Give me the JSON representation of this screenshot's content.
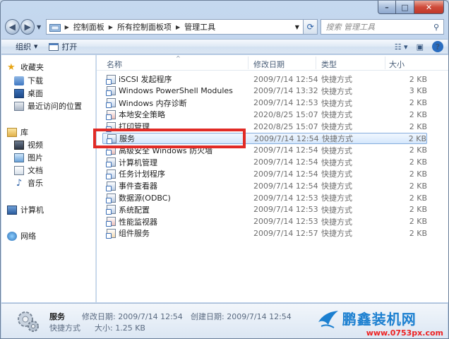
{
  "window": {
    "controls": {
      "minimize": "–",
      "maximize": "□",
      "close": "✕"
    }
  },
  "address": {
    "crumbs": [
      "控制面板",
      "所有控制面板项",
      "管理工具"
    ]
  },
  "search": {
    "placeholder": "搜索 管理工具"
  },
  "toolbar": {
    "organize": "组织",
    "open": "打开"
  },
  "nav": {
    "favorites": "收藏夹",
    "downloads": "下载",
    "desktop": "桌面",
    "recent": "最近访问的位置",
    "libraries": "库",
    "videos": "视频",
    "pictures": "图片",
    "documents": "文档",
    "music": "音乐",
    "computer": "计算机",
    "network": "网络"
  },
  "columns": {
    "name": "名称",
    "date": "修改日期",
    "type": "类型",
    "size": "大小"
  },
  "files": [
    {
      "name": "iSCSI 发起程序",
      "date": "2009/7/14 12:54",
      "type": "快捷方式",
      "size": "2 KB"
    },
    {
      "name": "Windows PowerShell Modules",
      "date": "2009/7/14 13:32",
      "type": "快捷方式",
      "size": "3 KB"
    },
    {
      "name": "Windows 内存诊断",
      "date": "2009/7/14 12:53",
      "type": "快捷方式",
      "size": "2 KB"
    },
    {
      "name": "本地安全策略",
      "date": "2020/8/25 15:07",
      "type": "快捷方式",
      "size": "2 KB"
    },
    {
      "name": "打印管理",
      "date": "2020/8/25 15:07",
      "type": "快捷方式",
      "size": "2 KB"
    },
    {
      "name": "服务",
      "date": "2009/7/14 12:54",
      "type": "快捷方式",
      "size": "2 KB"
    },
    {
      "name": "高级安全 Windows 防火墙",
      "date": "2009/7/14 12:54",
      "type": "快捷方式",
      "size": "2 KB"
    },
    {
      "name": "计算机管理",
      "date": "2009/7/14 12:54",
      "type": "快捷方式",
      "size": "2 KB"
    },
    {
      "name": "任务计划程序",
      "date": "2009/7/14 12:54",
      "type": "快捷方式",
      "size": "2 KB"
    },
    {
      "name": "事件查看器",
      "date": "2009/7/14 12:54",
      "type": "快捷方式",
      "size": "2 KB"
    },
    {
      "name": "数据源(ODBC)",
      "date": "2009/7/14 12:53",
      "type": "快捷方式",
      "size": "2 KB"
    },
    {
      "name": "系统配置",
      "date": "2009/7/14 12:53",
      "type": "快捷方式",
      "size": "2 KB"
    },
    {
      "name": "性能监视器",
      "date": "2009/7/14 12:53",
      "type": "快捷方式",
      "size": "2 KB"
    },
    {
      "name": "组件服务",
      "date": "2009/7/14 12:57",
      "type": "快捷方式",
      "size": "2 KB"
    }
  ],
  "details": {
    "name": "服务",
    "type": "快捷方式",
    "modified": "修改日期: 2009/7/14 12:54",
    "size": "大小: 1.25 KB",
    "created": "创建日期: 2009/7/14 12:54"
  },
  "watermark": {
    "title": "鹏鑫装机网",
    "url": "www.0753px.com"
  },
  "colors": {
    "highlight": "#e12b26",
    "selection": "#d5e7fc"
  }
}
